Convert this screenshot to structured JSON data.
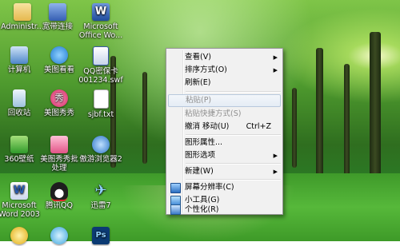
{
  "desktop_icons": [
    {
      "label": "Administr...",
      "color": "#f2d27a"
    },
    {
      "label": "宽带连接",
      "color": "#4b79c9"
    },
    {
      "label": "Microsoft Office Wo...",
      "color": "#2b5fb4"
    },
    {
      "label": "计算机",
      "color": "#6aa3e0"
    },
    {
      "label": "美图看看",
      "color": "#2d8fe0"
    },
    {
      "label": "QQ密保卡 001234.swf",
      "color": "#3a5ca8"
    },
    {
      "label": "回收站",
      "color": "#cfe3f4"
    },
    {
      "label": "美图秀秀",
      "color": "#e0357a"
    },
    {
      "label": "sjbf.txt",
      "color": "#ffffff"
    },
    {
      "label": "360壁纸",
      "color": "#56b84a"
    },
    {
      "label": "美图秀秀批处理",
      "color": "#f06b9e"
    },
    {
      "label": "傲游浏览器2",
      "color": "#3d8ad6"
    },
    {
      "label": "Microsoft Word 2003",
      "color": "#2a5db0"
    },
    {
      "label": "腾讯QQ",
      "color": "#1e1e1e"
    },
    {
      "label": "迅雷7",
      "color": "#2d7fd1"
    },
    {
      "label": "",
      "color": "#f4c430"
    },
    {
      "label": "",
      "color": "#4fb3e6"
    },
    {
      "label": "",
      "color": "#0b3a73"
    }
  ],
  "context_menu": {
    "items": [
      {
        "label": "查看(V)",
        "shortcut": "",
        "submenu": true,
        "disabled": false
      },
      {
        "label": "排序方式(O)",
        "shortcut": "",
        "submenu": true,
        "disabled": false
      },
      {
        "label": "刷新(E)",
        "shortcut": "",
        "submenu": false,
        "disabled": false
      },
      {
        "label": "粘贴(P)",
        "shortcut": "",
        "submenu": false,
        "disabled": true
      },
      {
        "label": "粘贴快捷方式(S)",
        "shortcut": "",
        "submenu": false,
        "disabled": true
      },
      {
        "label": "撤消 移动(U)",
        "shortcut": "Ctrl+Z",
        "submenu": false,
        "disabled": false
      },
      {
        "label": "图形属性...",
        "shortcut": "",
        "submenu": false,
        "disabled": false
      },
      {
        "label": "图形选项",
        "shortcut": "",
        "submenu": true,
        "disabled": false
      },
      {
        "label": "新建(W)",
        "shortcut": "",
        "submenu": true,
        "disabled": false
      },
      {
        "label": "屏幕分辨率(C)",
        "shortcut": "",
        "submenu": false,
        "disabled": false,
        "icon": "screen-resolution-icon"
      },
      {
        "label": "小工具(G)",
        "shortcut": "",
        "submenu": false,
        "disabled": false,
        "icon": "gadgets-icon"
      },
      {
        "label": "个性化(R)",
        "shortcut": "",
        "submenu": false,
        "disabled": false,
        "icon": "personalize-icon"
      }
    ],
    "submenu_arrow": "▶"
  }
}
